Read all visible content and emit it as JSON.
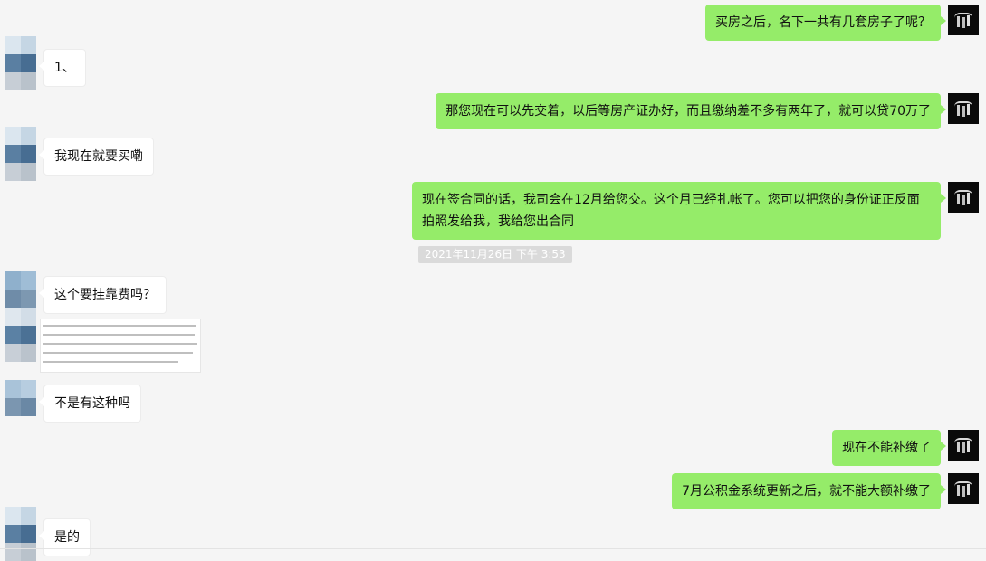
{
  "chat": {
    "messages": [
      {
        "side": "right",
        "text": "买房之后，名下一共有几套房子了呢？"
      },
      {
        "side": "left",
        "text": "1、"
      },
      {
        "side": "right",
        "text": "那您现在可以先交着，以后等房产证办好，而且缴纳差不多有两年了，就可以贷70万了"
      },
      {
        "side": "left",
        "text": "我现在就要买嘞"
      },
      {
        "side": "right",
        "text": "现在签合同的话，我司会在12月给您交。这个月已经扎帐了。您可以把您的身份证正反面拍照发给我，我给您出合同"
      },
      {
        "side": "left",
        "text": "这个要挂靠费吗？"
      },
      {
        "side": "left",
        "text": "不是有这种吗"
      },
      {
        "side": "right",
        "text": "现在不能补缴了"
      },
      {
        "side": "right",
        "text": "7月公积金系统更新之后，就不能大额补缴了"
      },
      {
        "side": "left",
        "text": "是的"
      }
    ],
    "timestamp": "2021年11月26日 下午 3:53"
  },
  "colors": {
    "background": "#f5f5f5",
    "bubble_right": "#95ec69",
    "bubble_left": "#ffffff",
    "timestamp_bg": "#dadada"
  }
}
